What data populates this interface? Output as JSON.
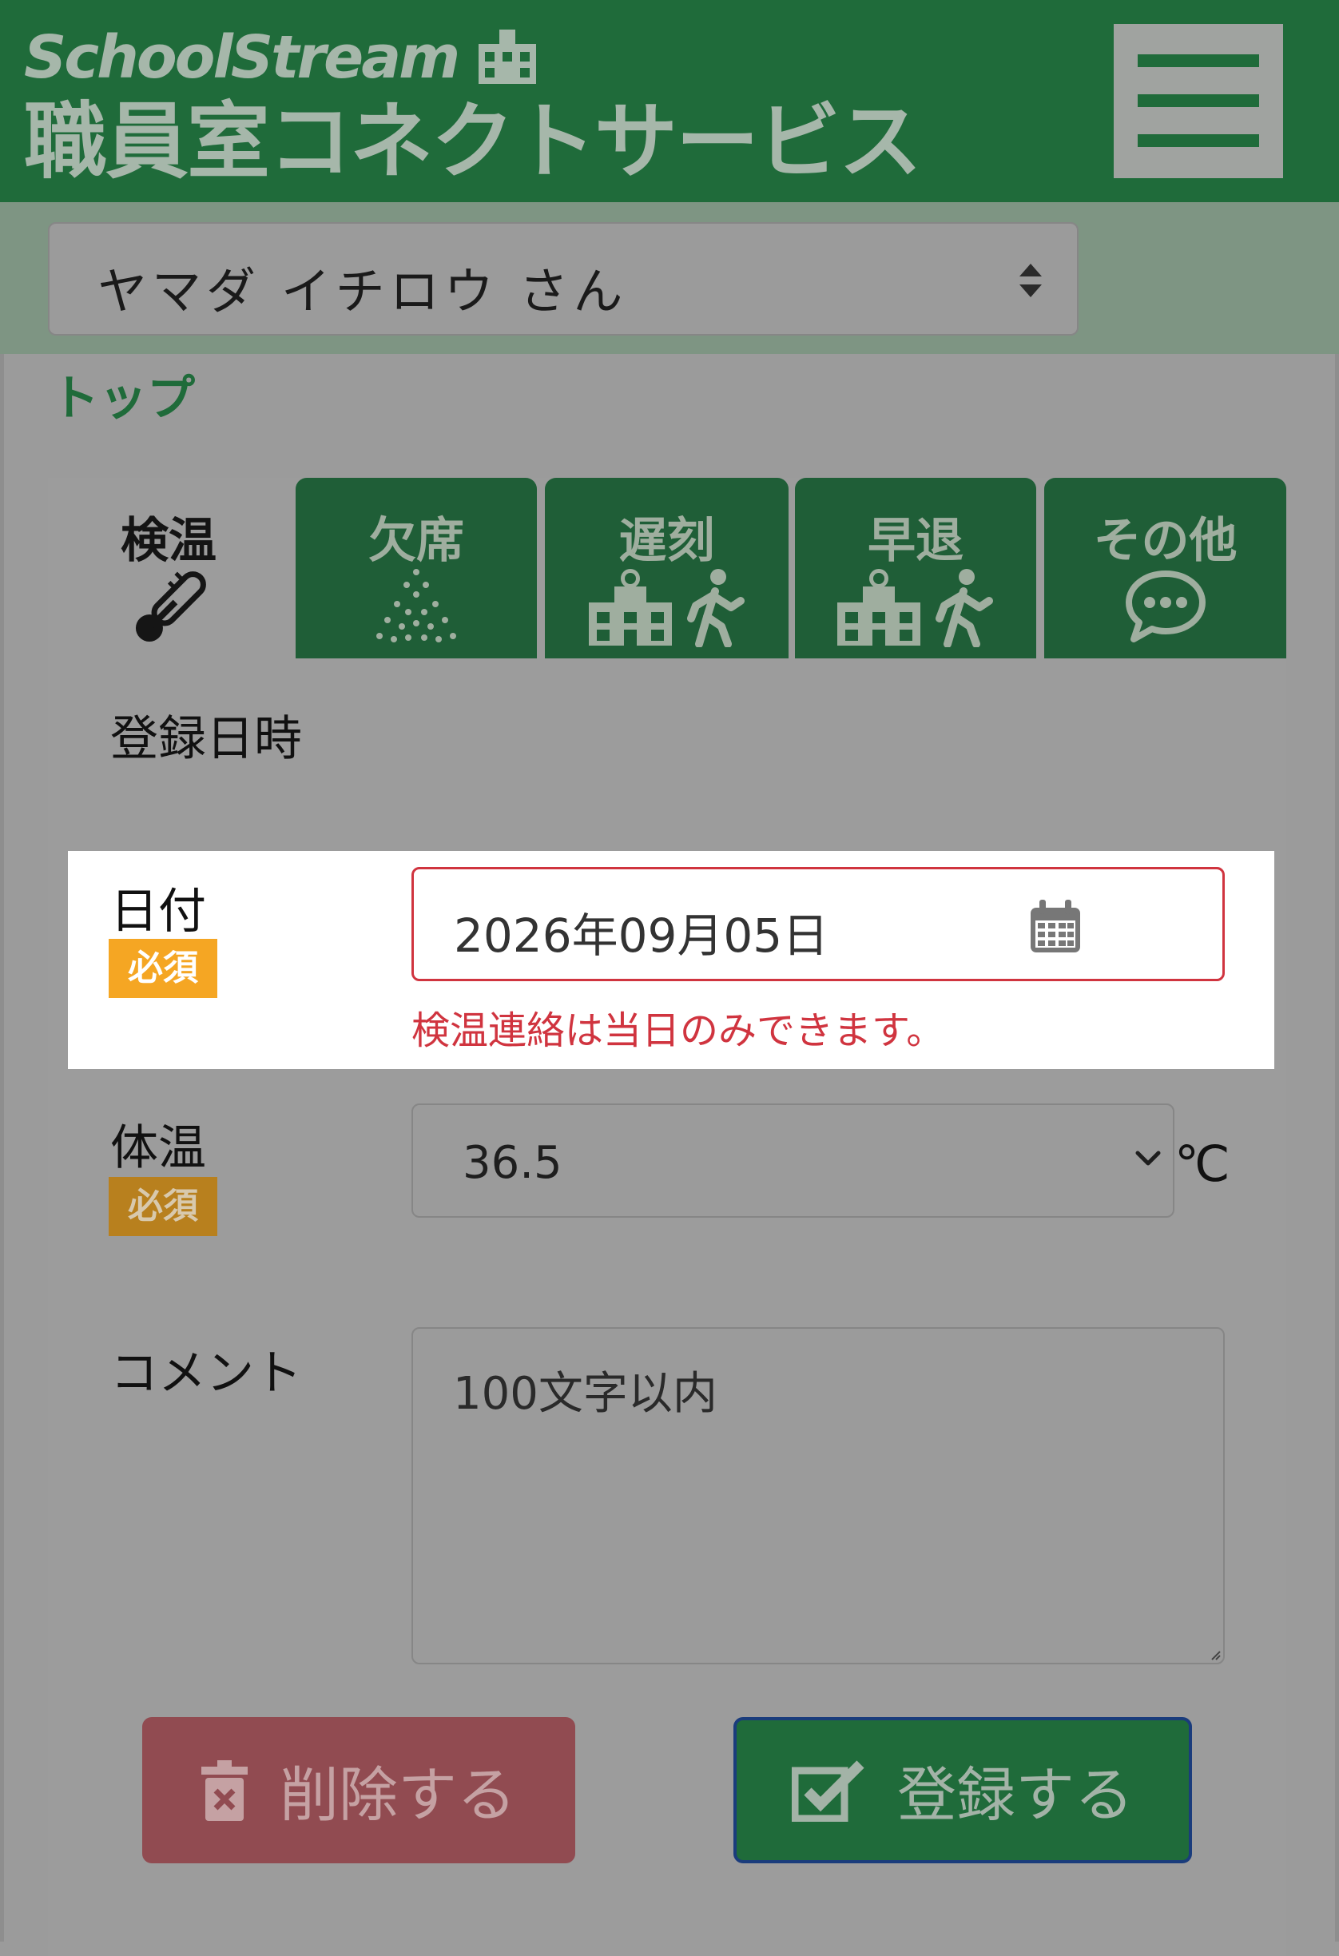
{
  "header": {
    "logo_en": "SchoolStream",
    "logo_ja": "職員室コネクトサービス"
  },
  "user": {
    "name": "ヤマダ イチロウ さん"
  },
  "breadcrumb": "トップ",
  "tabs": [
    {
      "label": "検温",
      "icon": "thermometer-icon",
      "active": true
    },
    {
      "label": "欠席",
      "icon": "sparkle-icon",
      "active": false
    },
    {
      "label": "遅刻",
      "icon": "school-walker-icon",
      "active": false
    },
    {
      "label": "早退",
      "icon": "school-walker-icon",
      "active": false
    },
    {
      "label": "その他",
      "icon": "chat-bubble-icon",
      "active": false
    }
  ],
  "form": {
    "section_title": "登録日時",
    "date_label": "日付",
    "required_badge": "必須",
    "date_value": "2026年09月05日",
    "date_error": "検温連絡は当日のみできます。",
    "temp_label": "体温",
    "temp_value": "36.5",
    "temp_unit": "℃",
    "comment_label": "コメント",
    "comment_placeholder": "100文字以内"
  },
  "buttons": {
    "delete_label": "削除する",
    "submit_label": "登録する"
  },
  "colors": {
    "brand_green": "#1f6b3a",
    "error_red": "#d0343f",
    "required_orange": "#f5a623",
    "delete_red": "#914b51"
  }
}
